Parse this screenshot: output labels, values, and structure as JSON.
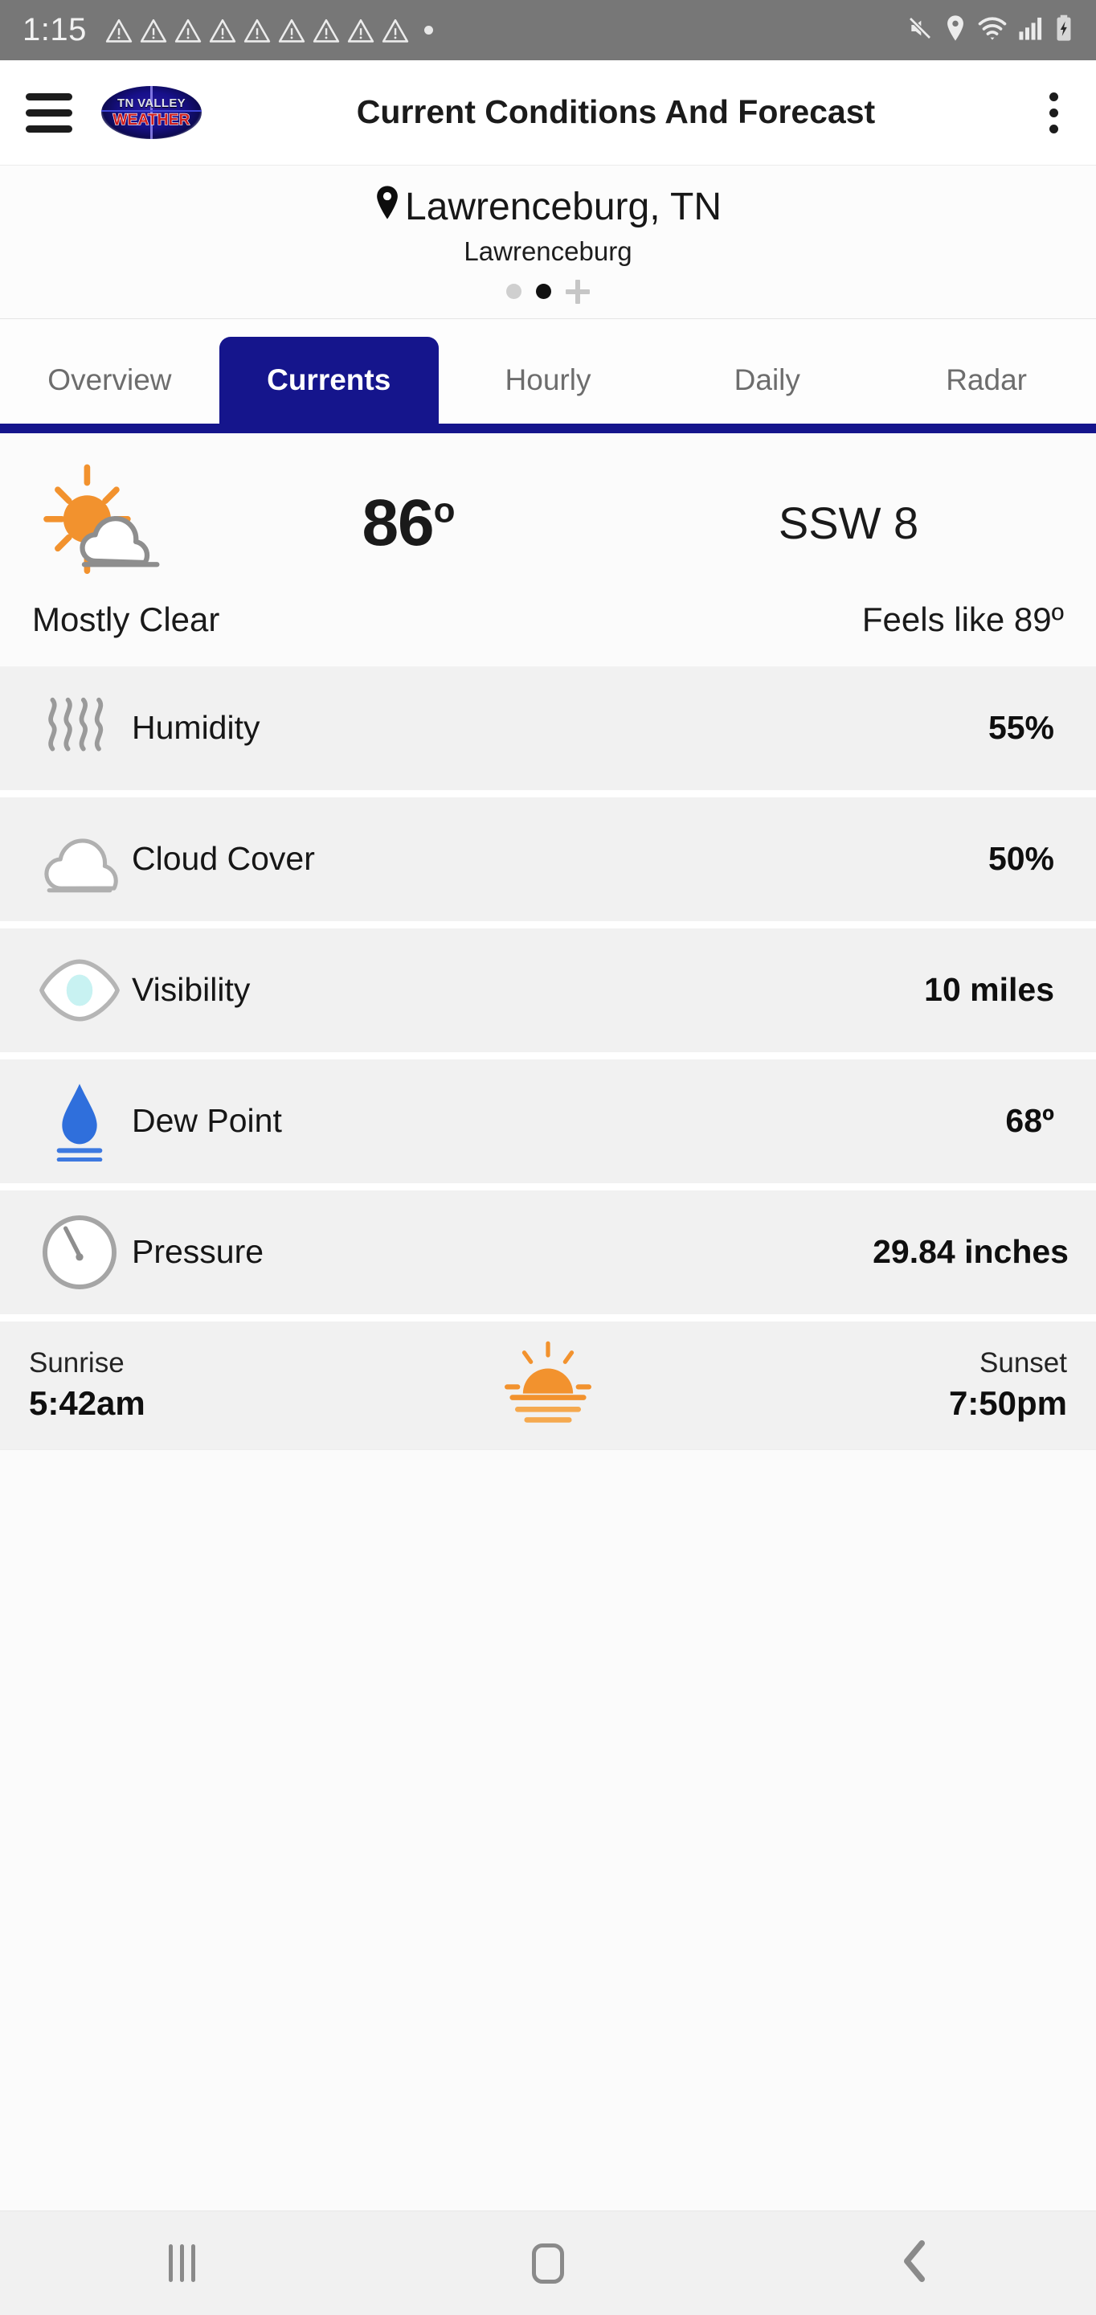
{
  "status_bar": {
    "time": "1:15",
    "warning_icon_count": 9,
    "icons": [
      "warning-triangle",
      "warning-triangle",
      "warning-triangle",
      "warning-triangle",
      "warning-triangle",
      "warning-triangle",
      "warning-triangle",
      "warning-triangle",
      "warning-triangle",
      "dot",
      "mute-icon",
      "location-icon",
      "wifi-icon",
      "signal-icon",
      "battery-charging-icon"
    ],
    "background": "#777777"
  },
  "app_bar": {
    "menu_icon": "hamburger-icon",
    "logo_top": "TN VALLEY",
    "logo_bottom": "WEATHER",
    "title": "Current Conditions And Forecast",
    "overflow_icon": "kebab-menu-icon"
  },
  "location": {
    "pin_icon": "location-pin-icon",
    "name": "Lawrenceburg, TN",
    "sub_name": "Lawrenceburg",
    "pager": {
      "count": 2,
      "active_index": 1,
      "add_label": "+"
    }
  },
  "tabs": {
    "items": [
      {
        "label": "Overview",
        "active": false
      },
      {
        "label": "Currents",
        "active": true
      },
      {
        "label": "Hourly",
        "active": false
      },
      {
        "label": "Daily",
        "active": false
      },
      {
        "label": "Radar",
        "active": false
      }
    ],
    "accent_color": "#15158c"
  },
  "current": {
    "weather_icon": "sun-behind-cloud-icon",
    "temperature": "86",
    "degree": "o",
    "wind": "SSW  8",
    "condition": "Mostly Clear",
    "feels_like": "Feels like 89º"
  },
  "details": [
    {
      "icon": "humidity-waves-icon",
      "label": "Humidity",
      "value": "55%"
    },
    {
      "icon": "cloud-icon",
      "label": "Cloud Cover",
      "value": "50%"
    },
    {
      "icon": "eye-visibility-icon",
      "label": "Visibility",
      "value": "10 miles"
    },
    {
      "icon": "water-drop-icon",
      "label": "Dew Point",
      "value": "68º"
    },
    {
      "icon": "pressure-gauge-icon",
      "label": "Pressure",
      "value": "29.84 inches"
    }
  ],
  "sun": {
    "sunrise_label": "Sunrise",
    "sunrise_time": "5:42am",
    "icon": "sunrise-icon",
    "sunset_label": "Sunset",
    "sunset_time": "7:50pm"
  },
  "nav_bar": {
    "recents_icon": "recents-icon",
    "home_icon": "home-icon",
    "back_icon": "back-chevron-icon"
  },
  "colors": {
    "accent": "#15158c",
    "sun": "#f2922e",
    "drop": "#2f6fdc",
    "row_bg": "#f1f1f1"
  }
}
